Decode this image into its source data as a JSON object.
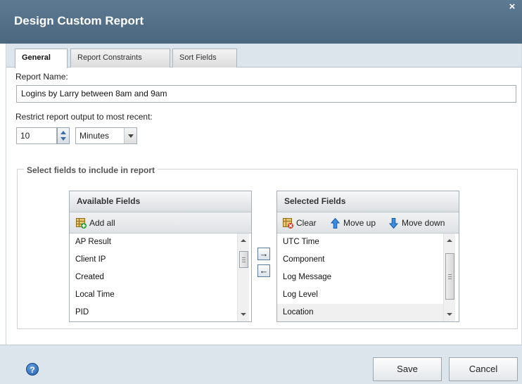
{
  "dialog": {
    "title": "Design Custom Report"
  },
  "tabs": [
    {
      "label": "General"
    },
    {
      "label": "Report Constraints"
    },
    {
      "label": "Sort Fields"
    }
  ],
  "form": {
    "report_name_label": "Report Name:",
    "report_name_value": "Logins by Larry between 8am and 9am",
    "restrict_label": "Restrict report output to most recent:",
    "restrict_value": "10",
    "restrict_unit": "Minutes"
  },
  "fields_section": {
    "legend": "Select fields to include in report",
    "available": {
      "header": "Available Fields",
      "add_all_label": "Add all",
      "items": [
        "AP Result",
        "Client IP",
        "Created",
        "Local Time",
        "PID"
      ]
    },
    "selected": {
      "header": "Selected Fields",
      "clear_label": "Clear",
      "move_up_label": "Move up",
      "move_down_label": "Move down",
      "items": [
        "UTC Time",
        "Component",
        "Log Message",
        "Log Level",
        "Location"
      ]
    },
    "move_right_symbol": "→",
    "move_left_symbol": "←"
  },
  "footer": {
    "help_symbol": "?",
    "save_label": "Save",
    "cancel_label": "Cancel"
  },
  "colors": {
    "titlebar": "#4f6b83",
    "footer_bg": "#dde5ec",
    "accent_blue": "#2a6fc9"
  }
}
